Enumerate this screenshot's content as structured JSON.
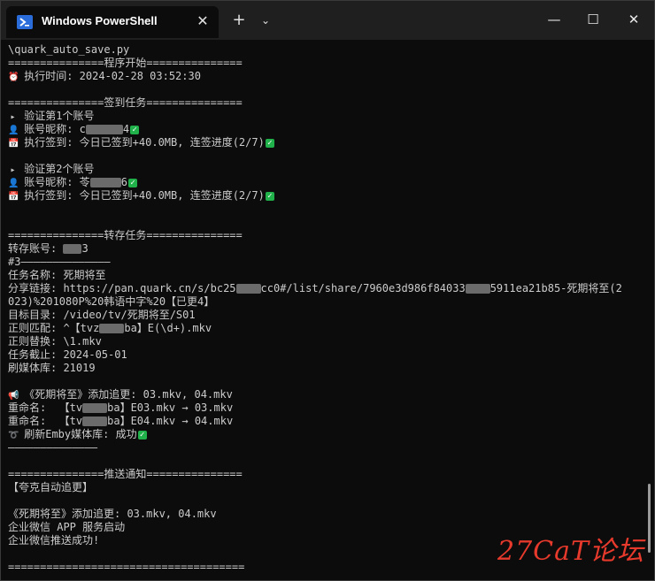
{
  "window": {
    "tab_title": "Windows PowerShell",
    "tab_close": "✕",
    "new_tab": "+",
    "dropdown": "⌄",
    "minimize": "—",
    "maximize": "☐",
    "close": "✕"
  },
  "terminal": {
    "lines": [
      {
        "t": "\\quark_auto_save.py"
      },
      {
        "t": "===============程序开始==============="
      },
      {
        "icon": "⏰",
        "t": " 执行时间: 2024-02-28 03:52:30"
      },
      {
        "t": ""
      },
      {
        "t": "===============签到任务==============="
      },
      {
        "icon": "▸",
        "t": " 验证第1个账号"
      },
      {
        "icon": "👤",
        "t": " 账号昵称: c",
        "mask": 6,
        "t2": "4",
        "ok": true
      },
      {
        "icon": "📅",
        "t": " 执行签到: 今日已签到+40.0MB, 连签进度(2/7)",
        "ok": true
      },
      {
        "t": ""
      },
      {
        "icon": "▸",
        "t": " 验证第2个账号"
      },
      {
        "icon": "👤",
        "t": " 账号昵称: 苓",
        "mask": 5,
        "t2": "6",
        "ok": true
      },
      {
        "icon": "📅",
        "t": " 执行签到: 今日已签到+40.0MB, 连签进度(2/7)",
        "ok": true
      },
      {
        "t": ""
      },
      {
        "t": ""
      },
      {
        "t": "===============转存任务==============="
      },
      {
        "t": "转存账号: ",
        "mask": 3,
        "t2": "3"
      },
      {
        "t": "#3——————————————"
      },
      {
        "t": "任务名称: 死期将至"
      },
      {
        "t": "分享链接: https://pan.quark.cn/s/bc25",
        "mask": 4,
        "t2": "cc0#/list/share/7960e3d986f84033",
        "mask2": 4,
        "t3": "5911ea21b85-死期将至(2"
      },
      {
        "t": "023)%201080P%20韩语中字%20【已更4】"
      },
      {
        "t": "目标目录: /video/tv/死期将至/S01"
      },
      {
        "t": "正则匹配: ^【tvz",
        "mask": 4,
        "t2": "ba】E(\\d+).mkv"
      },
      {
        "t": "正则替换: \\1.mkv"
      },
      {
        "t": "任务截止: 2024-05-01"
      },
      {
        "t": "刷媒体库: 21019"
      },
      {
        "t": ""
      },
      {
        "icon": "📢",
        "t": " 《死期将至》添加追更: 03.mkv, 04.mkv"
      },
      {
        "t": "重命名:  【tv",
        "mask": 4,
        "t2": "ba】E03.mkv → 03.mkv"
      },
      {
        "t": "重命名:  【tv",
        "mask": 4,
        "t2": "ba】E04.mkv → 04.mkv"
      },
      {
        "icon": "➰",
        "t": " 刷新Emby媒体库: 成功",
        "ok": true
      },
      {
        "t": "——————————————"
      },
      {
        "t": ""
      },
      {
        "t": "===============推送通知==============="
      },
      {
        "t": "【夸克自动追更】"
      },
      {
        "t": ""
      },
      {
        "t": "《死期将至》添加追更: 03.mkv, 04.mkv"
      },
      {
        "t": "企业微信 APP 服务启动"
      },
      {
        "t": "企业微信推送成功!"
      },
      {
        "t": ""
      },
      {
        "t": "====================================="
      }
    ]
  },
  "watermark": "27CaT论坛",
  "colors": {
    "accent": "#2b6cdb",
    "ok": "#21b14b",
    "watermark": "#e83a2c",
    "text": "#cccccc",
    "background": "#0c0c0c"
  }
}
